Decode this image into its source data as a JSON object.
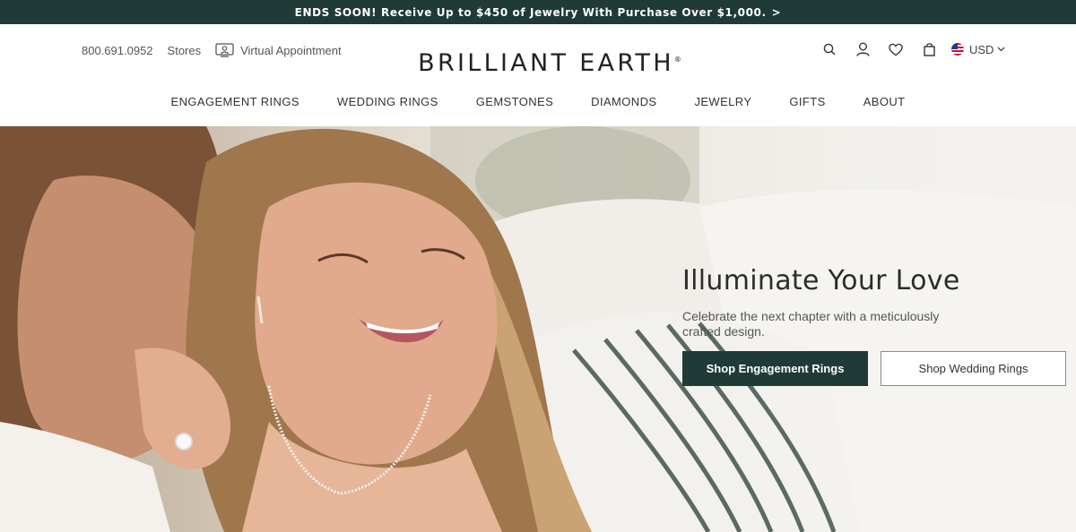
{
  "promo": {
    "text": "ENDS SOON! Receive Up to $450 of Jewelry With Purchase Over $1,000.",
    "chevron": ">"
  },
  "header": {
    "phone": "800.691.0952",
    "stores": "Stores",
    "virtual_appointment": "Virtual Appointment",
    "logo": "BRILLIANT EARTH",
    "logo_mark": "®",
    "currency": "USD",
    "icons": [
      "search-icon",
      "account-icon",
      "wishlist-heart-icon",
      "shopping-bag-icon",
      "us-flag-icon"
    ]
  },
  "nav": {
    "items": [
      "ENGAGEMENT RINGS",
      "WEDDING RINGS",
      "GEMSTONES",
      "DIAMONDS",
      "JEWELRY",
      "GIFTS",
      "ABOUT"
    ]
  },
  "hero": {
    "title": "Illuminate Your Love",
    "subtitle": "Celebrate the next chapter with a meticulously crafted design.",
    "primary_cta": "Shop Engagement Rings",
    "secondary_cta": "Shop Wedding Rings"
  },
  "colors": {
    "brand_dark_green": "#1f3a37",
    "text_dark": "#2c2c2c",
    "background": "#ffffff"
  }
}
